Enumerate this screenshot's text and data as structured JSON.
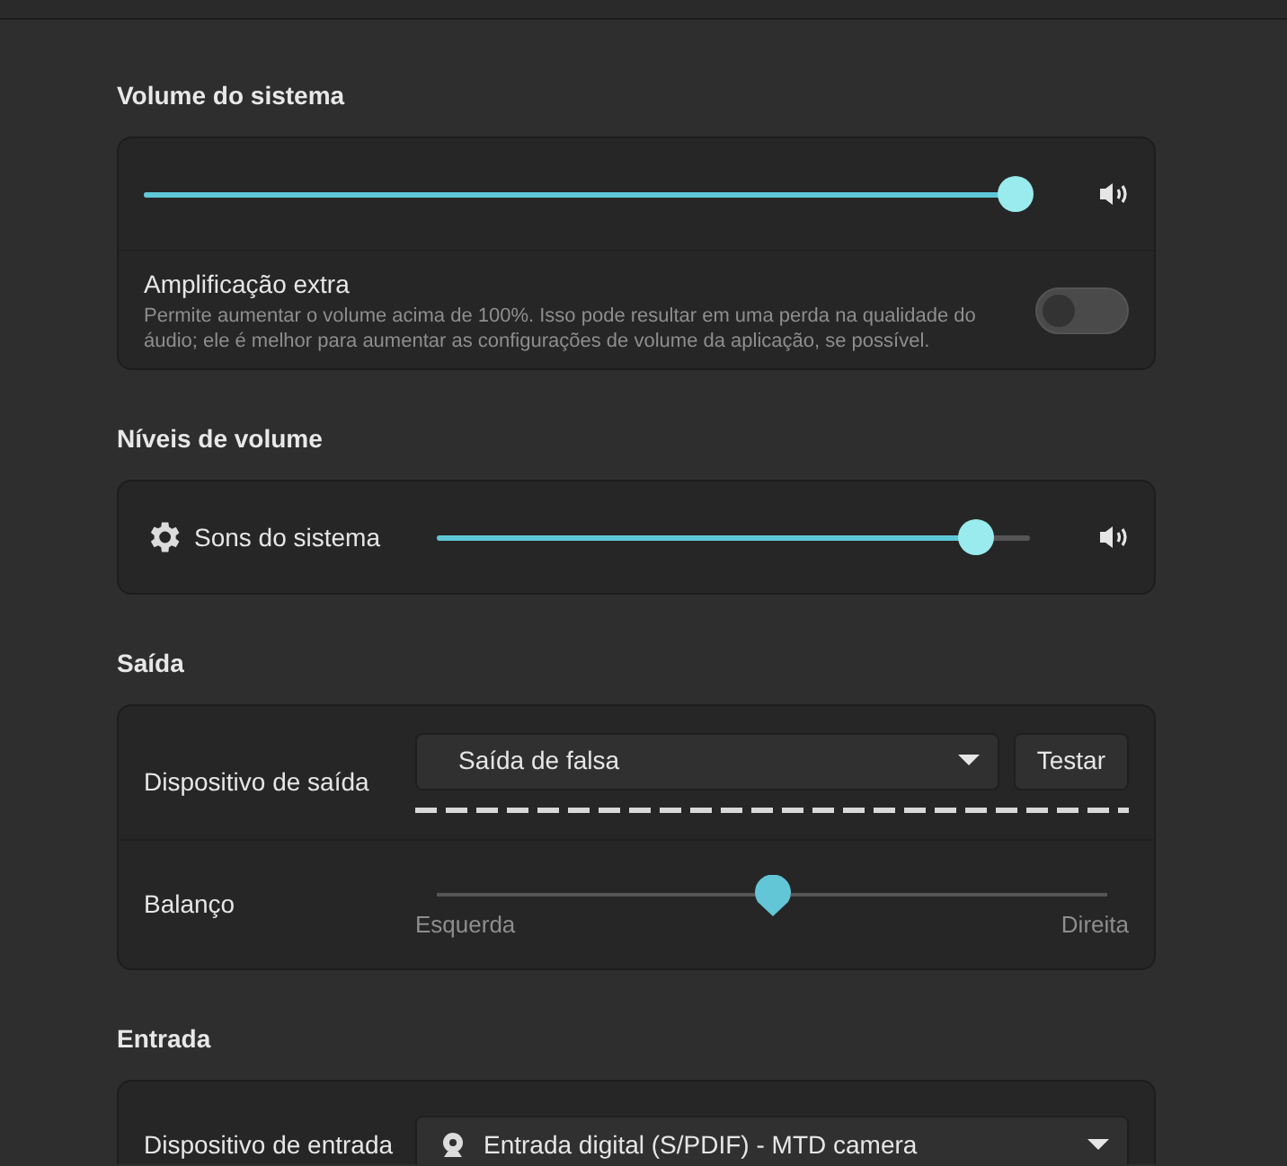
{
  "sections": [
    {
      "title": "Volume do sistema",
      "rows": [
        {
          "kind": "volume",
          "level": 1.0
        },
        {
          "kind": "toggle",
          "label": "Amplificação extra",
          "description": "Permite aumentar o volume acima de 100%. Isso pode resultar em uma perda na qualidade do áudio; ele é melhor para aumentar as configurações de volume da aplicação, se possível.",
          "on": false
        }
      ]
    },
    {
      "title": "Níveis de volume",
      "rows": [
        {
          "kind": "app-volume",
          "label": "Sons do sistema",
          "level": 0.91
        }
      ]
    },
    {
      "title": "Saída",
      "rows": [
        {
          "kind": "device",
          "label": "Dispositivo de saída",
          "value": "Saída de falsa",
          "button": "Testar",
          "meter": true
        },
        {
          "kind": "balance",
          "label": "Balanço",
          "level": 0.5,
          "left": "Esquerda",
          "right": "Direita"
        }
      ]
    },
    {
      "title": "Entrada",
      "rows": [
        {
          "kind": "device",
          "label": "Dispositivo de entrada",
          "value": "Entrada digital (S/PDIF) - MTD camera",
          "webcam": true
        }
      ]
    }
  ]
}
